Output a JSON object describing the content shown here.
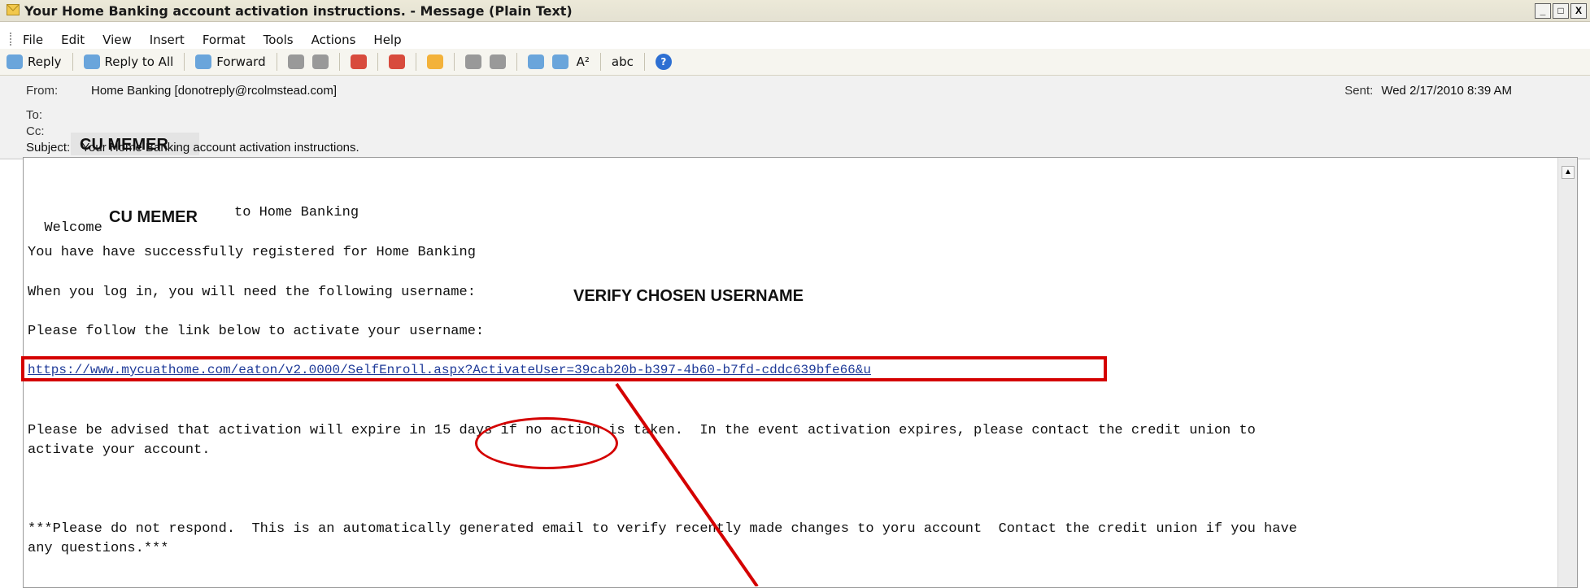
{
  "window": {
    "title": "Your Home Banking account activation instructions. - Message (Plain Text)",
    "buttons": [
      "_",
      "□",
      "X"
    ]
  },
  "menu": [
    "File",
    "Edit",
    "View",
    "Insert",
    "Format",
    "Tools",
    "Actions",
    "Help"
  ],
  "toolbar": {
    "reply": "Reply",
    "reply_all": "Reply to All",
    "forward": "Forward",
    "font_icon_text": "A²",
    "abc_icon_text": "abc",
    "help_icon_text": "?"
  },
  "header": {
    "from_label": "From:",
    "from_value": "Home Banking [donotreply@rcolmstead.com]",
    "sent_label": "Sent:",
    "sent_value": "Wed 2/17/2010 8:39 AM",
    "to_label": "To:",
    "cc_label": "Cc:",
    "to_name": "CU MEMER",
    "subject_label": "Subject:",
    "subject_value": "Your Home Banking account activation instructions."
  },
  "body": {
    "welcome_prefix": "Welcome",
    "welcome_name": "CU MEMER",
    "welcome_suffix": "to Home Banking",
    "line_registered": "You have have successfully registered for Home Banking",
    "line_username_prefix": "When you log in, you will need the following username:",
    "line_username_value": "VERIFY CHOSEN USERNAME",
    "line_follow": "Please follow the link below to activate your username:",
    "link": "https://www.mycuathome.com/eaton/v2.0000/SelfEnroll.aspx?ActivateUser=39cab20b-b397-4b60-b7fd-cddc639bfe66&u",
    "line_expire_1": "Please be advised that activation will expire in 15 days if no action is taken.  In the event activation expires, please contact the credit union to",
    "line_expire_2": "activate your account.",
    "line_noreply_1": "***Please do not respond.  This is an automatically generated email to verify recently made changes to yoru account  Contact the credit union if you have",
    "line_noreply_2": "any questions.***"
  },
  "colors": {
    "annotation_red": "#d40000",
    "link_blue": "#1f3b99"
  }
}
